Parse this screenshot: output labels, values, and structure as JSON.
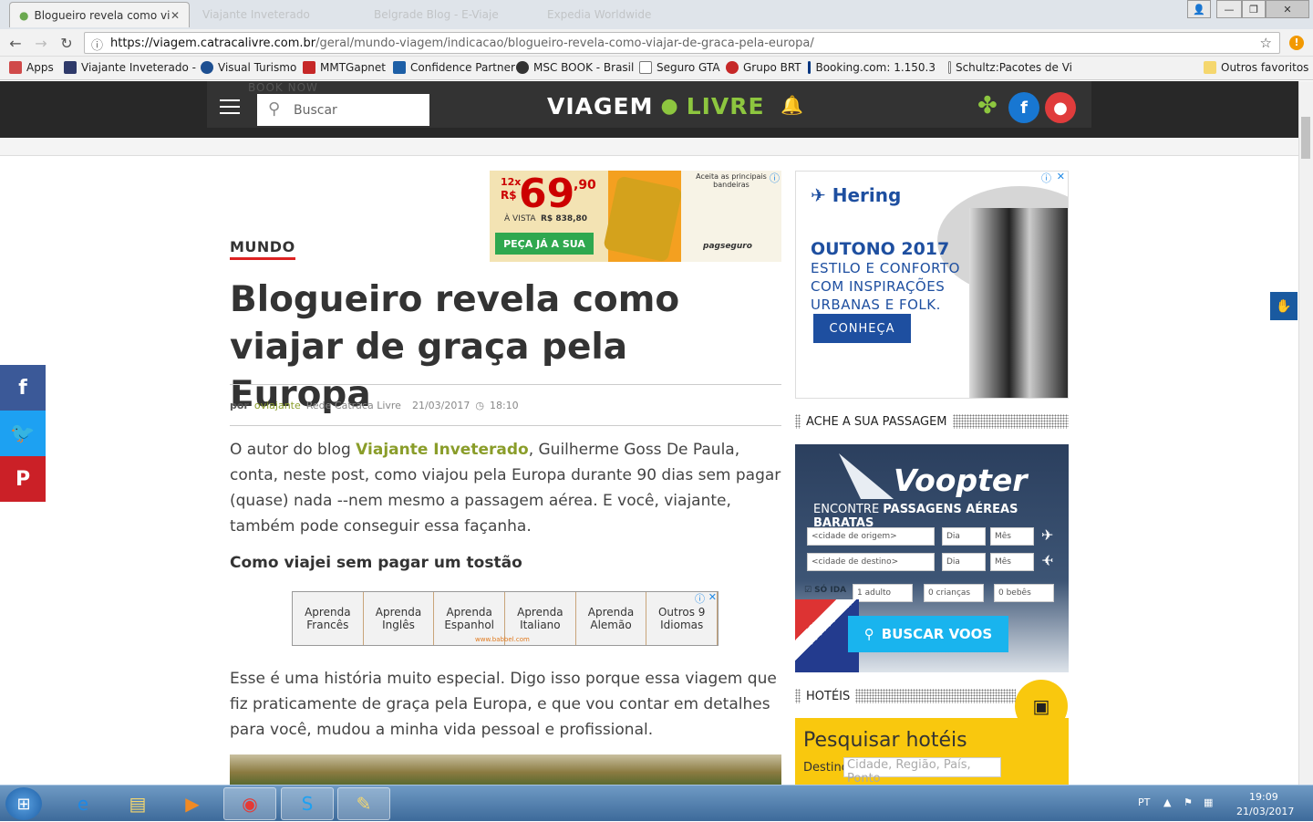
{
  "browser": {
    "tabs": [
      {
        "label": "Blogueiro revela como vi",
        "active": true
      },
      {
        "label": "Viajante Inveterado",
        "active": false
      },
      {
        "label": "Belgrade Blog - E-Viaje",
        "active": false
      },
      {
        "label": "Expedia Worldwide",
        "active": false
      }
    ],
    "tab_close": "✕",
    "url_host": "https://viagem.catracalivre.com.br",
    "url_path": "/geral/mundo-viagem/indicacao/blogueiro-revela-como-viajar-de-graca-pela-europa/",
    "bookmarks": [
      {
        "label": "Apps",
        "color": "#d04a4a"
      },
      {
        "label": "Viajante Inveterado -",
        "color": "#2f3a6a"
      },
      {
        "label": "Visual Turismo",
        "color": "#1d4f91"
      },
      {
        "label": "MMTGapnet",
        "color": "#c62828"
      },
      {
        "label": "Confidence Partner",
        "color": "#1d5fa6"
      },
      {
        "label": "MSC BOOK - Brasil",
        "color": "#333333"
      },
      {
        "label": "Seguro GTA",
        "color": "#777777"
      },
      {
        "label": "Grupo BRT",
        "color": "#c62828"
      },
      {
        "label": "Booking.com: 1.150.3",
        "color": "#003580"
      },
      {
        "label": "Schultz:Pacotes de Vi",
        "color": "#777777"
      }
    ],
    "other_bookmarks": "Outros favoritos"
  },
  "site": {
    "search_placeholder": "Buscar",
    "logo_text_1": "VIAGEM",
    "logo_text_2": "LIVRE",
    "book_now": "BOOK NOW"
  },
  "ad_top": {
    "installments": "12x",
    "currency": "R$",
    "price": "69",
    "cents": ",90",
    "cash_price_label": "À VISTA",
    "cash_price": "R$ 838,80",
    "cta": "PEÇA JÁ A SUA",
    "accepted": "Aceita as principais bandeiras",
    "brand": "pagseguro"
  },
  "article": {
    "category": "MUNDO",
    "title": "Blogueiro revela como viajar de graça pela Europa",
    "by_label": "por",
    "author": "oviajante",
    "network": "Rede Catraca Livre",
    "date": "21/03/2017",
    "time": "18:10",
    "p1_start": "O autor do blog ",
    "p1_link": "Viajante Inveterado",
    "p1_end": ", Guilherme Goss De Paula, conta, neste post, como viajou pela Europa durante 90 dias sem pagar (quase) nada --nem mesmo a passagem aérea. E você, viajante, também pode conseguir essa façanha.",
    "subhead": "Como viajei sem pagar um tostão",
    "p2": "Esse é uma história muito especial. Digo isso porque essa viagem que fiz praticamente de graça pela Europa, e que vou contar em detalhes para você, mudou a minha vida pessoal e profissional."
  },
  "babbel_ad": {
    "cells": [
      "Aprenda Francês",
      "Aprenda Inglês",
      "Aprenda Espanhol",
      "Aprenda Italiano",
      "Aprenda Alemão",
      "Outros 9 Idiomas"
    ],
    "source": "www.babbel.com"
  },
  "hering_ad": {
    "brand": "Hering",
    "headline": "OUTONO 2017",
    "body": "ESTILO E CONFORTO COM INSPIRAÇÕES URBANAS E FOLK.",
    "cta": "CONHEÇA"
  },
  "sidebar": {
    "flights_heading": "ACHE A SUA PASSAGEM",
    "hotels_heading": "HOTÉIS"
  },
  "voopter": {
    "brand": "Voopter",
    "tagline_pre": "ENCONTRE ",
    "tagline_bold": "PASSAGENS AÉREAS BARATAS",
    "origin_placeholder": "<cidade de origem>",
    "dest_placeholder": "<cidade de destino>",
    "day": "Dia",
    "month": "Mês",
    "one_way": "SÓ IDA",
    "adults": "1 adulto",
    "children": "0 crianças",
    "babies": "0 bebês",
    "search_button": "BUSCAR VOOS"
  },
  "hotels": {
    "title": "Pesquisar hotéis",
    "dest_label": "Destino",
    "dest_placeholder": "Cidade, Região, País, Ponto"
  },
  "taskbar": {
    "lang": "PT",
    "time": "19:09",
    "date": "21/03/2017"
  }
}
